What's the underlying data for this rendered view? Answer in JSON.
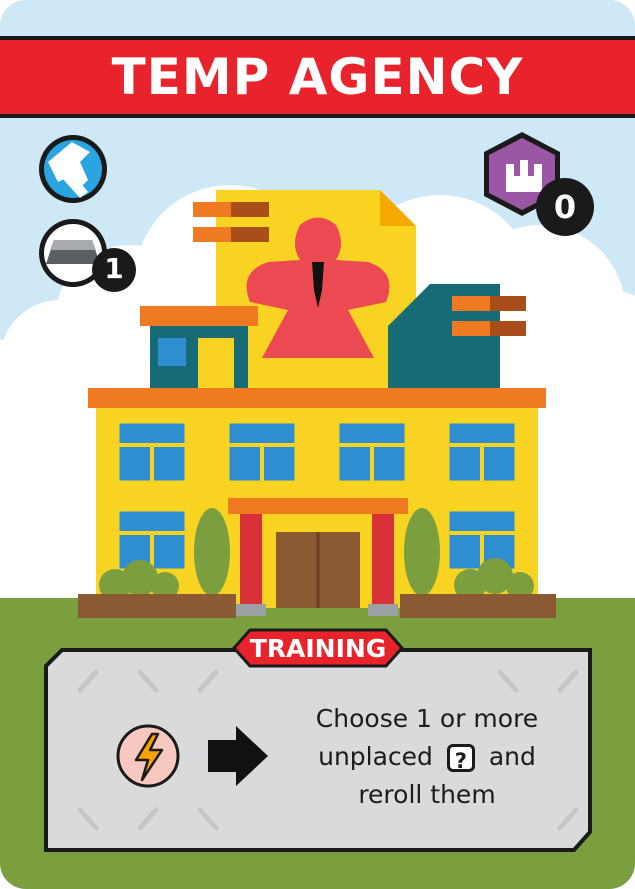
{
  "card": {
    "title": "TEMP AGENCY",
    "ability_tag": "TRAINING",
    "effect": {
      "line1": "Choose 1 or more",
      "line2_before": "unplaced",
      "die_symbol": "?",
      "line2_after": "and",
      "line3": "reroll them"
    },
    "build_cost_value": "1",
    "pollution_value": "0",
    "icons": {
      "build_type": "hammer-icon",
      "material": "steel-ingot-icon",
      "pollution": "factory-icon",
      "trigger": "lightning-icon",
      "arrow": "arrow-right-icon"
    },
    "colors": {
      "banner_red": "#e8232b",
      "sky": "#cfe8f6",
      "grass": "#7b9f3f",
      "building_yellow": "#f8d322",
      "roof_orange": "#ef7a21",
      "teal": "#166b77",
      "window_blue": "#2f8ed0",
      "pollution_purple": "#9b57a5"
    }
  }
}
